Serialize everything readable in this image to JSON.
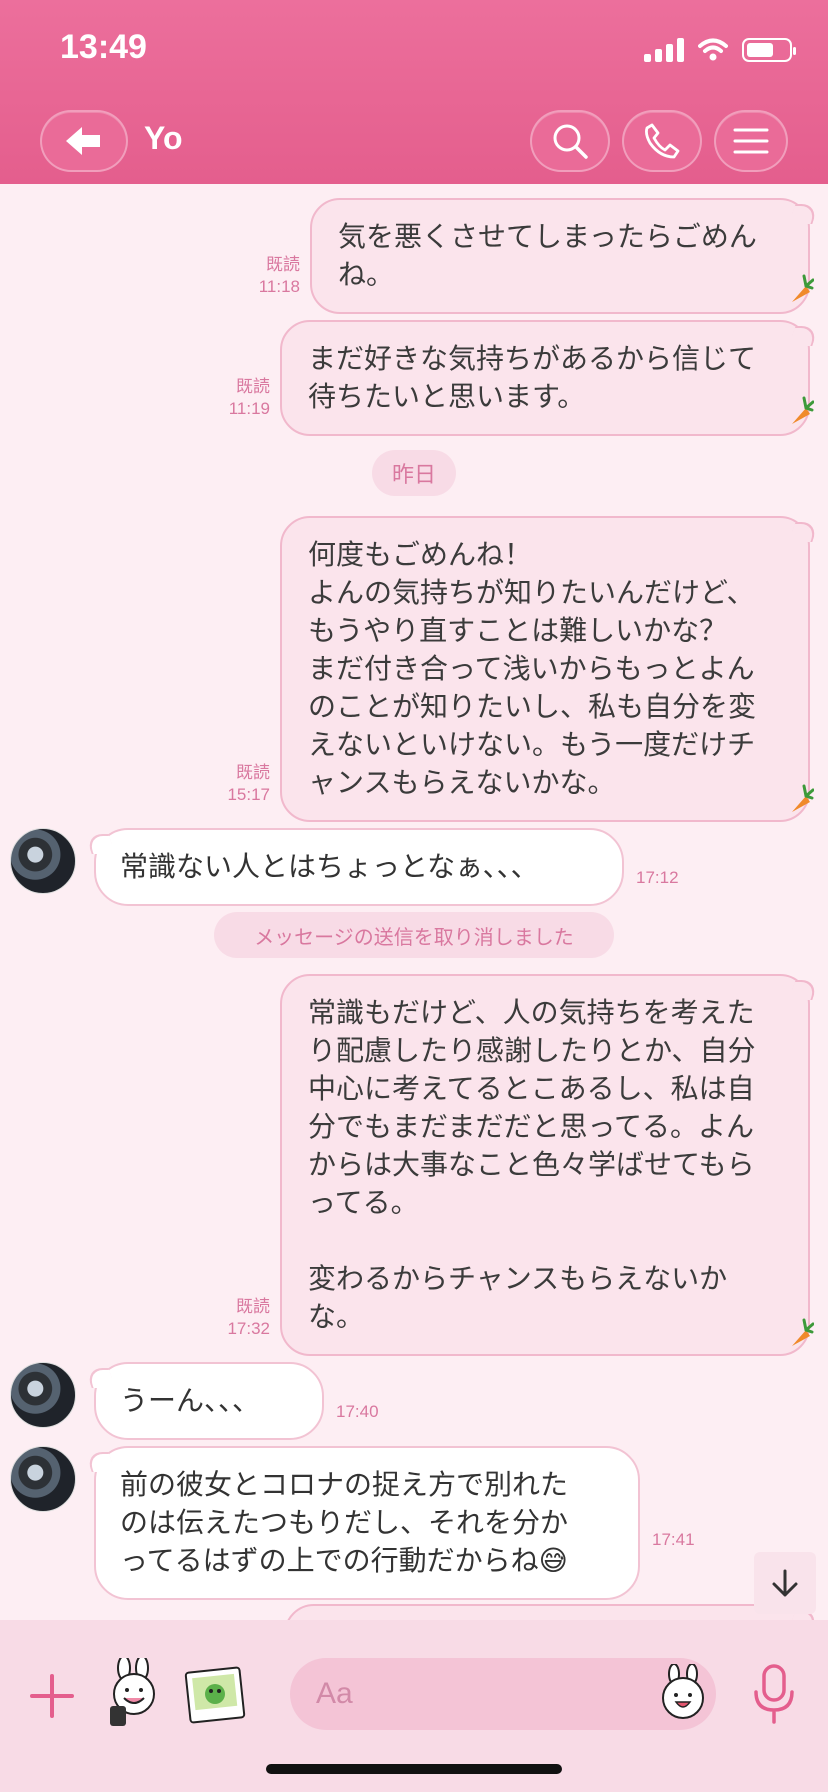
{
  "status_bar": {
    "time": "13:49"
  },
  "header": {
    "title": "Yo"
  },
  "date_separator": "昨日",
  "notice": "メッセージの送信を取り消しました",
  "read_label": "既読",
  "messages": [
    {
      "type": "sent",
      "text": "気を悪くさせてしまったらごめん\nね。",
      "time": "11:18"
    },
    {
      "type": "sent",
      "text": "まだ好きな気持ちがあるから信じて\n待ちたいと思います。",
      "time": "11:19"
    },
    {
      "type": "sent",
      "text": "何度もごめんね！\nよんの気持ちが知りたいんだけど、\nもうやり直すことは難しいかな？\nまだ付き合って浅いからもっとよん\nのことが知りたいし、私も自分を変\nえないといけない。もう一度だけチ\nャンスもらえないかな。",
      "time": "15:17"
    },
    {
      "type": "received",
      "text": "常識ない人とはちょっとなぁ、、、",
      "time": "17:12"
    },
    {
      "type": "sent",
      "text": "常識もだけど、人の気持ちを考えた\nり配慮したり感謝したりとか、自分\n中心に考えてるとこあるし、私は自\n分でもまだまだだと思ってる。よん\nからは大事なこと色々学ばせてもら\nってる。\n\n変わるからチャンスもらえないか\nな。",
      "time": "17:32"
    },
    {
      "type": "received",
      "text": "うーん、、、",
      "time": "17:40"
    },
    {
      "type": "received",
      "text": "前の彼女とコロナの捉え方で別れた\nのは伝えたつもりだし、それを分か\nってるはずの上での行動だからね😅",
      "time": "17:41"
    }
  ],
  "input": {
    "placeholder": "Aa"
  },
  "icons": {
    "back": "back-arrow-icon",
    "search": "search-icon",
    "call": "phone-icon",
    "menu": "menu-icon",
    "plus": "plus-icon",
    "sticker": "sticker-icon",
    "photo": "photo-icon",
    "emoji": "emoji-icon",
    "mic": "microphone-icon",
    "scroll": "arrow-down-icon",
    "read_mark": "carrot-icon"
  },
  "colors": {
    "header": "#e8669a",
    "accent": "#e45e8d",
    "sent_bubble": "#fbe4ec",
    "received_bubble": "#ffffff"
  }
}
